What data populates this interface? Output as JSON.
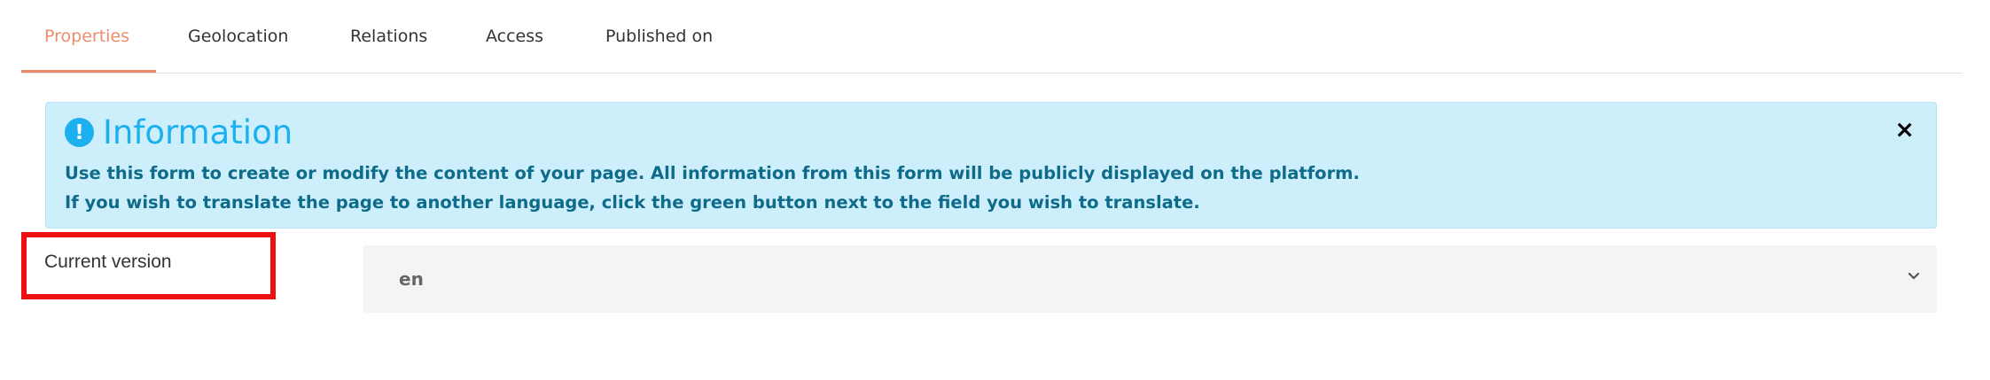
{
  "tabs": [
    {
      "label": "Properties",
      "active": true
    },
    {
      "label": "Geolocation",
      "active": false
    },
    {
      "label": "Relations",
      "active": false
    },
    {
      "label": "Access",
      "active": false
    },
    {
      "label": "Published on",
      "active": false
    }
  ],
  "alert": {
    "title": "Information",
    "line1": "Use this form to create or modify the content of your page. All information from this form will be publicly displayed on the platform.",
    "line2": "If you wish to translate the page to another language, click the green button next to the field you wish to translate.",
    "icon": "exclamation-circle-icon",
    "close_label": "×"
  },
  "form": {
    "current_version_label": "Current version",
    "current_version_value": "en",
    "chevron_icon": "chevron-down-icon"
  },
  "colors": {
    "accent": "#ee8b6d",
    "info_bg": "#cdeefb",
    "info_title": "#1cb1ee",
    "info_text": "#0e6b8a",
    "highlight": "#ee0f0f"
  }
}
